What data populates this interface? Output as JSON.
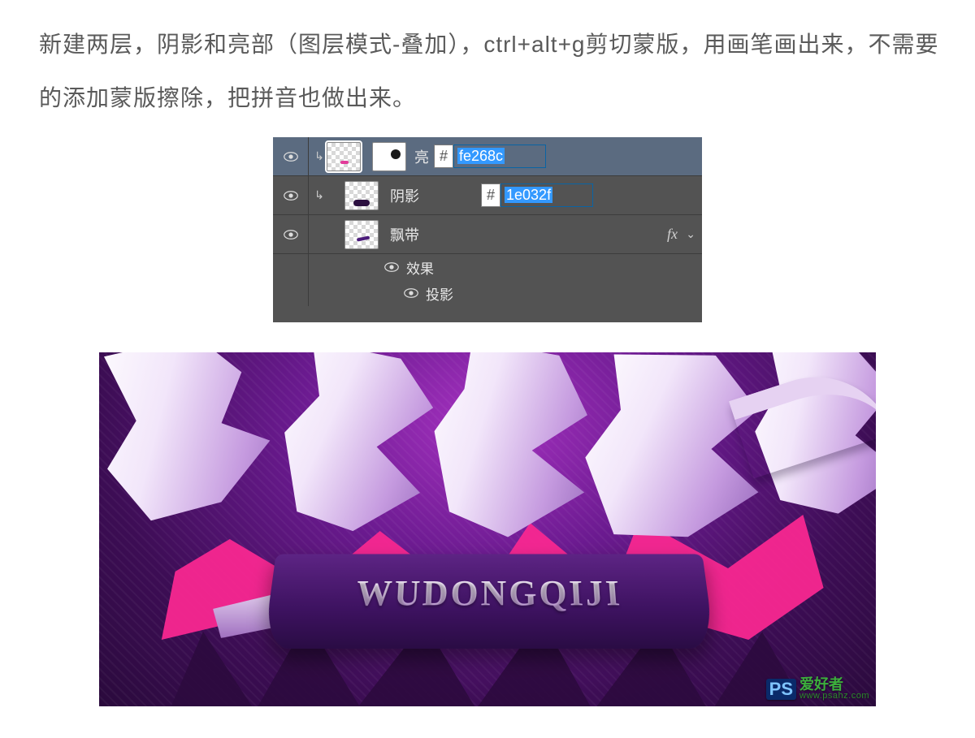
{
  "instruction": "新建两层，阴影和亮部（图层模式-叠加），ctrl+alt+g剪切蒙版，用画笔画出来，不需要的添加蒙版擦除，把拼音也做出来。",
  "layers": {
    "row1": {
      "name": "亮",
      "hex": "fe268c"
    },
    "row2": {
      "name": "阴影",
      "hex": "1e032f"
    },
    "row3": {
      "name": "飘带",
      "fx": "fx"
    },
    "effects_label": "效果",
    "dropshadow_label": "投影",
    "hash": "#"
  },
  "artwork": {
    "banner_text": "WUDONGQIJI"
  },
  "watermark": {
    "ps": "PS",
    "line1": "爱好者",
    "line2": "www.psahz.com"
  }
}
